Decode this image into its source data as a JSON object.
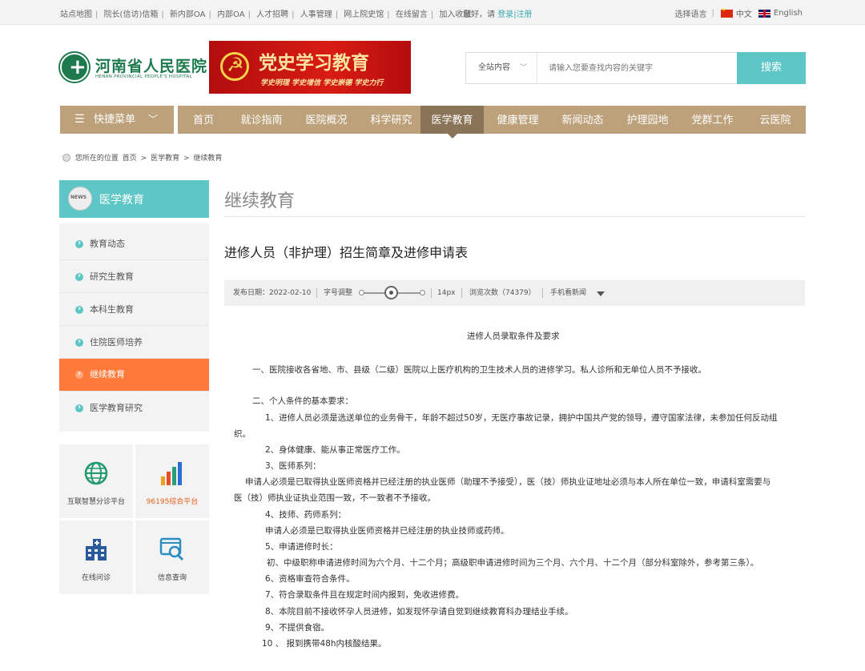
{
  "topbar": {
    "links": [
      "站点地图",
      "院长(信访)信箱",
      "新内部OA",
      "内部OA",
      "人才招聘",
      "人事管理",
      "网上院史馆",
      "在线留言",
      "加入收藏"
    ],
    "greeting": "您好，请",
    "login": "登录",
    "divider": "|",
    "register": "注册",
    "lang_label": "选择语言",
    "lang_cn": "中文",
    "lang_en": "English"
  },
  "header": {
    "logo_cn": "河南省人民医院",
    "logo_en": "HENAN PROVINCIAL PEOPLE'S HOSPITAL",
    "banner_title": "党史学习教育",
    "banner_slogan": "学史明理 学史增信 学史崇德 学史力行",
    "search_scope": "全站内容",
    "search_placeholder": "请输入您要查找内容的关键字",
    "search_button": "搜索"
  },
  "nav": {
    "quick_menu": "快捷菜单",
    "items": [
      "首页",
      "就诊指南",
      "医院概况",
      "科学研究",
      "医学教育",
      "健康管理",
      "新闻动态",
      "护理园地",
      "党群工作",
      "云医院"
    ],
    "active": "医学教育"
  },
  "breadcrumb": [
    "您所在的位置",
    "首页",
    ">",
    "医学教育",
    ">",
    "继续教育"
  ],
  "sidebar": {
    "title": "医学教育",
    "items": [
      "教育动态",
      "研究生教育",
      "本科生教育",
      "住院医师培养",
      "继续教育",
      "医学教育研究"
    ],
    "active": "继续教育",
    "tiles": [
      "互联智慧分诊平台",
      "96195综合平台",
      "在线问诊",
      "信息查询"
    ]
  },
  "main": {
    "page_title": "继续教育",
    "article_title": "进修人员（非护理）招生简章及进修申请表",
    "meta": {
      "date": "发布日期：2022-02-10",
      "font_label": "字号调整",
      "font_size": "14px",
      "views": "浏览次数（74379）",
      "mobile": "手机看新闻"
    },
    "content": [
      "进修人员录取条件及要求",
      "一、医院接收各省地、市、县级（二级）医院以上医疗机构的卫生技术人员的进修学习。私人诊所和无单位人员不予接收。",
      "二、个人条件的基本要求：",
      "1、进修人员必须是选送单位的业务骨干，年龄不超过50岁，无医疗事故记录，拥护中国共产党的领导，遵守国家法律，未参加任何反动组",
      "织。",
      "2、身体健康、能从事正常医疗工作。",
      "3、医师系列：",
      "申请人必须是已取得执业医师资格并已经注册的执业医师（助理不予接受），医（技）师执业证地址必须与本人所在单位一致，申请科室需要与",
      "医（技）师执业证执业范围一致，不一致者不予接收。",
      "4、技师、药师系列：",
      "申请人必须是已取得执业医师资格并已经注册的执业技师或药师。",
      "5、申请进修时长：",
      "初、中级职称申请进修时间为六个月、十二个月；高级职申请进修时间为三个月、六个月、十二个月（部分科室除外，参考第三条）。",
      "6、资格审查符合条件。",
      "7、符合录取条件且在规定时间内报到，免收进修费。",
      "8、本院目前不接收怀孕人员进修，如发现怀孕请自觉到继续教育科办理结业手续。",
      "9、不提供食宿。",
      "10 、 报到携带48h内核酸结果。"
    ]
  },
  "colors": {
    "teal": "#5ec6c6",
    "nav_brown": "#bca17a",
    "nav_active": "#8a7457",
    "sidebar_active": "#ff7a3a",
    "banner_red": "#d81c14"
  }
}
